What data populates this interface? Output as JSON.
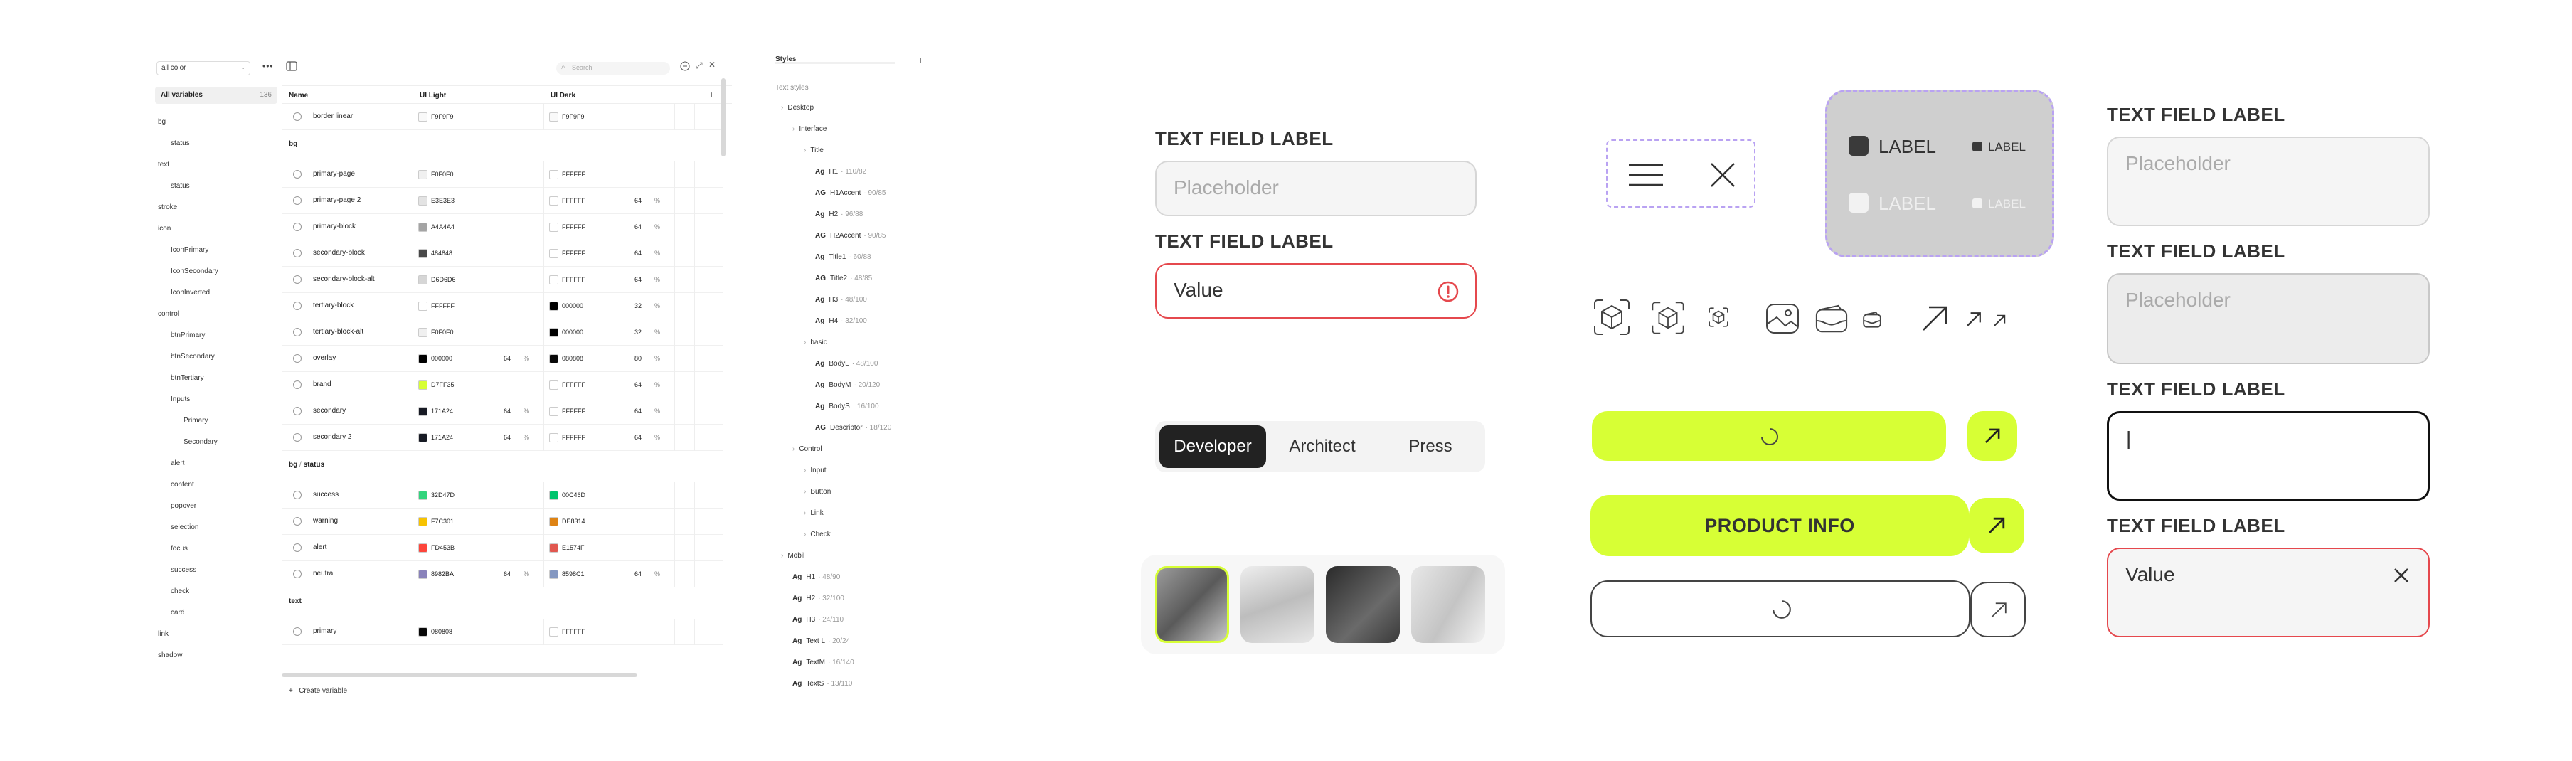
{
  "variables": {
    "collection": "all color",
    "all_label": "All variables",
    "all_count": "136",
    "groups": [
      {
        "label": "bg",
        "indent": 0
      },
      {
        "label": "status",
        "indent": 1
      },
      {
        "label": "text",
        "indent": 0
      },
      {
        "label": "status",
        "indent": 1
      },
      {
        "label": "stroke",
        "indent": 0
      },
      {
        "label": "icon",
        "indent": 0
      },
      {
        "label": "IconPrimary",
        "indent": 1
      },
      {
        "label": "IconSecondary",
        "indent": 1
      },
      {
        "label": "IconInverted",
        "indent": 1
      },
      {
        "label": "control",
        "indent": 0
      },
      {
        "label": "btnPrimary",
        "indent": 1
      },
      {
        "label": "btnSecondary",
        "indent": 1
      },
      {
        "label": "btnTertiary",
        "indent": 1
      },
      {
        "label": "Inputs",
        "indent": 1
      },
      {
        "label": "Primary",
        "indent": 2
      },
      {
        "label": "Secondary",
        "indent": 2
      },
      {
        "label": "alert",
        "indent": 1
      },
      {
        "label": "content",
        "indent": 1
      },
      {
        "label": "popover",
        "indent": 1
      },
      {
        "label": "selection",
        "indent": 1
      },
      {
        "label": "focus",
        "indent": 1
      },
      {
        "label": "success",
        "indent": 1
      },
      {
        "label": "check",
        "indent": 1
      },
      {
        "label": "card",
        "indent": 1
      },
      {
        "label": "link",
        "indent": 0
      },
      {
        "label": "shadow",
        "indent": 0
      }
    ],
    "search_placeholder": "Search",
    "headers": {
      "name": "Name",
      "light": "UI Light",
      "dark": "UI Dark"
    },
    "rows": [
      {
        "type": "row",
        "name": "border linear",
        "l": "F9F9F9",
        "lc": "#F9F9F9",
        "lo": "",
        "d": "F9F9F9",
        "dc": "#F9F9F9",
        "do": ""
      },
      {
        "type": "section",
        "title": "bg",
        "sub": ""
      },
      {
        "type": "row",
        "name": "primary-page",
        "l": "F0F0F0",
        "lc": "#F0F0F0",
        "lo": "",
        "d": "FFFFFF",
        "dc": "#FFFFFF",
        "do": ""
      },
      {
        "type": "row",
        "name": "primary-page 2",
        "l": "E3E3E3",
        "lc": "#E3E3E3",
        "lo": "",
        "d": "FFFFFF",
        "dc": "#FFFFFF",
        "do": "64"
      },
      {
        "type": "row",
        "name": "primary-block",
        "l": "A4A4A4",
        "lc": "#A4A4A4",
        "lo": "",
        "d": "FFFFFF",
        "dc": "#FFFFFF",
        "do": "64"
      },
      {
        "type": "row",
        "name": "secondary-block",
        "l": "484848",
        "lc": "#484848",
        "lo": "",
        "d": "FFFFFF",
        "dc": "#FFFFFF",
        "do": "64"
      },
      {
        "type": "row",
        "name": "secondary-block-alt",
        "l": "D6D6D6",
        "lc": "#D6D6D6",
        "lo": "",
        "d": "FFFFFF",
        "dc": "#FFFFFF",
        "do": "64"
      },
      {
        "type": "row",
        "name": "tertiary-block",
        "l": "FFFFFF",
        "lc": "#FFFFFF",
        "lo": "",
        "d": "000000",
        "dc": "#000000",
        "do": "32"
      },
      {
        "type": "row",
        "name": "tertiary-block-alt",
        "l": "F0F0F0",
        "lc": "#F0F0F0",
        "lo": "",
        "d": "000000",
        "dc": "#000000",
        "do": "32"
      },
      {
        "type": "row",
        "name": "overlay",
        "l": "000000",
        "lc": "#000000",
        "lo": "64",
        "d": "080808",
        "dc": "#080808",
        "do": "80"
      },
      {
        "type": "row",
        "name": "brand",
        "l": "D7FF35",
        "lc": "#D7FF35",
        "lo": "",
        "d": "FFFFFF",
        "dc": "#FFFFFF",
        "do": "64"
      },
      {
        "type": "row",
        "name": "secondary",
        "l": "171A24",
        "lc": "#171A24",
        "lo": "64",
        "d": "FFFFFF",
        "dc": "#FFFFFF",
        "do": "64"
      },
      {
        "type": "row",
        "name": "secondary 2",
        "l": "171A24",
        "lc": "#171A24",
        "lo": "64",
        "d": "FFFFFF",
        "dc": "#FFFFFF",
        "do": "64"
      },
      {
        "type": "section",
        "title": "bg",
        "sub": "status"
      },
      {
        "type": "row",
        "name": "success",
        "l": "32D47D",
        "lc": "#32D47D",
        "lo": "",
        "d": "00C46D",
        "dc": "#00C46D",
        "do": ""
      },
      {
        "type": "row",
        "name": "warning",
        "l": "F7C301",
        "lc": "#F7C301",
        "lo": "",
        "d": "DE8314",
        "dc": "#DE8314",
        "do": ""
      },
      {
        "type": "row",
        "name": "alert",
        "l": "FD453B",
        "lc": "#FD453B",
        "lo": "",
        "d": "E1574F",
        "dc": "#E1574F",
        "do": ""
      },
      {
        "type": "row",
        "name": "neutral",
        "l": "8982BA",
        "lc": "#8982BA",
        "lo": "64",
        "d": "8598C1",
        "dc": "#8598C1",
        "do": "64"
      },
      {
        "type": "section",
        "title": "text",
        "sub": ""
      },
      {
        "type": "row",
        "name": "primary",
        "l": "080808",
        "lc": "#080808",
        "lo": "",
        "d": "FFFFFF",
        "dc": "#FFFFFF",
        "do": ""
      }
    ],
    "create_label": "Create variable"
  },
  "styles": {
    "title": "Styles",
    "text_styles": "Text styles",
    "items": [
      {
        "label": "Desktop",
        "ag": "",
        "spec": "",
        "indent": 0
      },
      {
        "label": "Interface",
        "ag": "",
        "spec": "",
        "indent": 1
      },
      {
        "label": "Title",
        "ag": "",
        "spec": "",
        "indent": 2
      },
      {
        "label": "H1",
        "ag": "Ag",
        "spec": "110/82",
        "indent": 3
      },
      {
        "label": "H1Accent",
        "ag": "AG",
        "spec": "90/85",
        "indent": 3
      },
      {
        "label": "H2",
        "ag": "Ag",
        "spec": "96/88",
        "indent": 3
      },
      {
        "label": "H2Accent",
        "ag": "AG",
        "spec": "90/85",
        "indent": 3
      },
      {
        "label": "Title1",
        "ag": "Ag",
        "spec": "60/88",
        "indent": 3
      },
      {
        "label": "Title2",
        "ag": "AG",
        "spec": "48/85",
        "indent": 3
      },
      {
        "label": "H3",
        "ag": "Ag",
        "spec": "48/100",
        "indent": 3
      },
      {
        "label": "H4",
        "ag": "Ag",
        "spec": "32/100",
        "indent": 3
      },
      {
        "label": "basic",
        "ag": "",
        "spec": "",
        "indent": 2
      },
      {
        "label": "BodyL",
        "ag": "Ag",
        "spec": "48/100",
        "indent": 3
      },
      {
        "label": "BodyM",
        "ag": "Ag",
        "spec": "20/120",
        "indent": 3
      },
      {
        "label": "BodyS",
        "ag": "Ag",
        "spec": "16/100",
        "indent": 3
      },
      {
        "label": "Descriptor",
        "ag": "AG",
        "spec": "18/120",
        "indent": 3
      },
      {
        "label": "Control",
        "ag": "",
        "spec": "",
        "indent": 1
      },
      {
        "label": "Input",
        "ag": "",
        "spec": "",
        "indent": 2
      },
      {
        "label": "Button",
        "ag": "",
        "spec": "",
        "indent": 2
      },
      {
        "label": "Link",
        "ag": "",
        "spec": "",
        "indent": 2
      },
      {
        "label": "Check",
        "ag": "",
        "spec": "",
        "indent": 2
      },
      {
        "label": "Mobil",
        "ag": "",
        "spec": "",
        "indent": 0
      },
      {
        "label": "H1",
        "ag": "Ag",
        "spec": "48/90",
        "indent": 1
      },
      {
        "label": "H2",
        "ag": "Ag",
        "spec": "32/100",
        "indent": 1
      },
      {
        "label": "H3",
        "ag": "Ag",
        "spec": "24/110",
        "indent": 1
      },
      {
        "label": "Text L",
        "ag": "Ag",
        "spec": "20/24",
        "indent": 1
      },
      {
        "label": "TextM",
        "ag": "Ag",
        "spec": "16/140",
        "indent": 1
      },
      {
        "label": "TextS",
        "ag": "Ag",
        "spec": "13/110",
        "indent": 1
      }
    ]
  },
  "fields_left": {
    "label1": "TEXT FIELD LABEL",
    "placeholder": "Placeholder",
    "label2": "TEXT FIELD LABEL",
    "value": "Value"
  },
  "tabs": [
    "Developer",
    "Architect",
    "Press"
  ],
  "card": {
    "label_lg": "LABEL",
    "label_sm": "LABEL"
  },
  "product_button": "PRODUCT INFO",
  "fields_right": {
    "label1": "TEXT FIELD LABEL",
    "placeholder1": "Placeholder",
    "label2": "TEXT FIELD LABEL",
    "placeholder2": "Placeholder",
    "label3": "TEXT FIELD LABEL",
    "cursor": "|",
    "label4": "TEXT FIELD LABEL",
    "value4": "Value"
  },
  "colors": {
    "brand": "#D7FF35",
    "alert": "#E5484D",
    "purple": "#B9A2F2"
  }
}
